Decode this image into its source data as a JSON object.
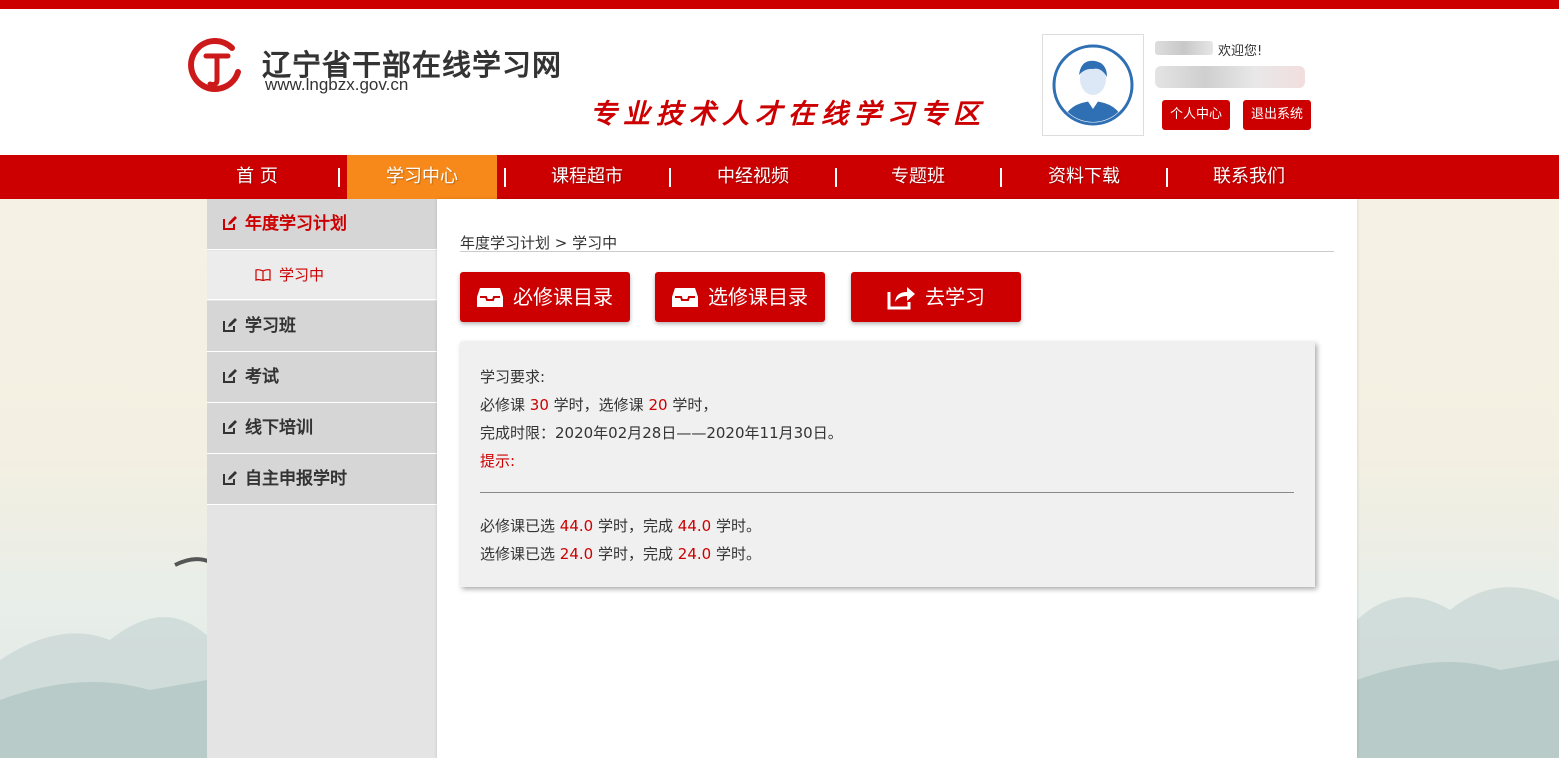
{
  "site": {
    "title": "辽宁省干部在线学习网",
    "url": "www.lngbzx.gov.cn",
    "slogan": "专业技术人才在线学习专区"
  },
  "user": {
    "welcome": "欢迎您!",
    "center_label": "个人中心",
    "logout_label": "退出系统"
  },
  "nav": {
    "items": [
      "首 页",
      "学习中心",
      "课程超市",
      "中经视频",
      "专题班",
      "资料下载",
      "联系我们"
    ],
    "active": "学习中心"
  },
  "sidebar": {
    "items": [
      "年度学习计划",
      "学习班",
      "考试",
      "线下培训",
      "自主申报学时"
    ],
    "sub_item": "学习中"
  },
  "main": {
    "breadcrumb": "年度学习计划 > 学习中",
    "buttons": [
      "必修课目录",
      "选修课目录",
      "去学习"
    ],
    "requirements": {
      "heading": "学习要求:",
      "required_prefix": "必修课",
      "required_hours": "30",
      "mid_text": "学时，选修课",
      "elective_hours": "20",
      "end_text": "学时，",
      "deadline": "完成时限：2020年02月28日——2020年11月30日。",
      "tip": "提示:"
    },
    "progress": {
      "req_prefix": "必修课已选",
      "req_selected": "44.0",
      "req_mid": "学时，完成",
      "req_done": "44.0",
      "req_end": "学时。",
      "ele_prefix": "选修课已选",
      "ele_selected": "24.0",
      "ele_mid": "学时，完成",
      "ele_done": "24.0",
      "ele_end": "学时。"
    }
  },
  "colors": {
    "brand_red": "#cc0000",
    "nav_active": "#f7891b"
  }
}
